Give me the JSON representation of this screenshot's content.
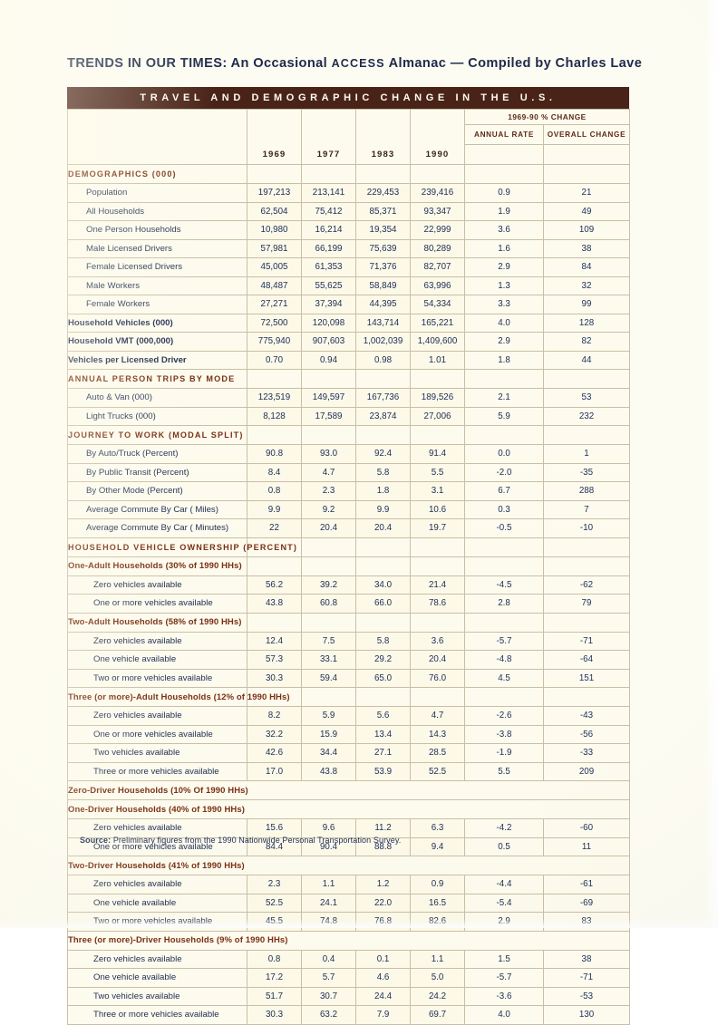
{
  "document": {
    "title_main": "TRENDS IN OUR TIMES:",
    "title_rest_1": " An Occasional ",
    "title_access": "ACCESS",
    "title_rest_2": " Almanac — Compiled by Charles Lave",
    "banner": "TRAVEL AND DEMOGRAPHIC CHANGE IN THE U.S.",
    "source_label": "Source:",
    "source_text": " Preliminary figures from the 1990 Nationwide Personal Transportation Survey."
  },
  "colors": {
    "banner_bg": "#4a2318",
    "section_text": "#7a2f14",
    "data_text": "#20305a",
    "paper": "#fdfbee",
    "rule": "#c9bfa6"
  },
  "table": {
    "header": {
      "group_label": "1969-90 % CHANGE",
      "years": [
        "1969",
        "1977",
        "1983",
        "1990"
      ],
      "annual_rate": "ANNUAL RATE",
      "overall_change": "OVERALL CHANGE"
    },
    "rows": [
      {
        "type": "section",
        "label": "DEMOGRAPHICS (000)"
      },
      {
        "type": "data",
        "indent": 1,
        "label": "Population",
        "values": [
          "197,213",
          "213,141",
          "229,453",
          "239,416",
          "0.9",
          "21"
        ]
      },
      {
        "type": "data",
        "indent": 1,
        "label": "All Households",
        "values": [
          "62,504",
          "75,412",
          "85,371",
          "93,347",
          "1.9",
          "49"
        ]
      },
      {
        "type": "data",
        "indent": 1,
        "label": "One Person Households",
        "values": [
          "10,980",
          "16,214",
          "19,354",
          "22,999",
          "3.6",
          "109"
        ]
      },
      {
        "type": "data",
        "indent": 1,
        "label": "Male Licensed Drivers",
        "values": [
          "57,981",
          "66,199",
          "75,639",
          "80,289",
          "1.6",
          "38"
        ]
      },
      {
        "type": "data",
        "indent": 1,
        "label": "Female Licensed Drivers",
        "values": [
          "45,005",
          "61,353",
          "71,376",
          "82,707",
          "2.9",
          "84"
        ]
      },
      {
        "type": "data",
        "indent": 1,
        "label": "Male Workers",
        "values": [
          "48,487",
          "55,625",
          "58,849",
          "63,996",
          "1.3",
          "32"
        ]
      },
      {
        "type": "data",
        "indent": 1,
        "label": "Female Workers",
        "values": [
          "27,271",
          "37,394",
          "44,395",
          "54,334",
          "3.3",
          "99"
        ]
      },
      {
        "type": "data",
        "indent": 0,
        "bold": true,
        "label": "Household Vehicles (000)",
        "values": [
          "72,500",
          "120,098",
          "143,714",
          "165,221",
          "4.0",
          "128"
        ]
      },
      {
        "type": "data",
        "indent": 0,
        "bold": true,
        "label": "Household VMT (000,000)",
        "values": [
          "775,940",
          "907,603",
          "1,002,039",
          "1,409,600",
          "2.9",
          "82"
        ]
      },
      {
        "type": "data",
        "indent": 0,
        "bold": true,
        "label": "Vehicles per Licensed Driver",
        "values": [
          "0.70",
          "0.94",
          "0.98",
          "1.01",
          "1.8",
          "44"
        ]
      },
      {
        "type": "section",
        "label": "ANNUAL PERSON TRIPS BY MODE"
      },
      {
        "type": "data",
        "indent": 1,
        "label": "Auto & Van (000)",
        "values": [
          "123,519",
          "149,597",
          "167,736",
          "189,526",
          "2.1",
          "53"
        ]
      },
      {
        "type": "data",
        "indent": 1,
        "label": "Light Trucks (000)",
        "values": [
          "8,128",
          "17,589",
          "23,874",
          "27,006",
          "5.9",
          "232"
        ]
      },
      {
        "type": "section",
        "label": "JOURNEY TO WORK (MODAL SPLIT)"
      },
      {
        "type": "data",
        "indent": 1,
        "label": "By Auto/Truck (Percent)",
        "values": [
          "90.8",
          "93.0",
          "92.4",
          "91.4",
          "0.0",
          "1"
        ]
      },
      {
        "type": "data",
        "indent": 1,
        "label": "By Public Transit (Percent)",
        "values": [
          "8.4",
          "4.7",
          "5.8",
          "5.5",
          "-2.0",
          "-35"
        ]
      },
      {
        "type": "data",
        "indent": 1,
        "label": "By Other Mode (Percent)",
        "values": [
          "0.8",
          "2.3",
          "1.8",
          "3.1",
          "6.7",
          "288"
        ]
      },
      {
        "type": "data",
        "indent": 1,
        "label": "Average Commute By Car ( Miles)",
        "values": [
          "9.9",
          "9.2",
          "9.9",
          "10.6",
          "0.3",
          "7"
        ]
      },
      {
        "type": "data",
        "indent": 1,
        "label": "Average Commute By Car ( Minutes)",
        "values": [
          "22",
          "20.4",
          "20.4",
          "19.7",
          "-0.5",
          "-10"
        ]
      },
      {
        "type": "section",
        "label": "HOUSEHOLD VEHICLE OWNERSHIP (PERCENT)"
      },
      {
        "type": "subsection",
        "label": "One-Adult Households (30% of 1990 HHs)"
      },
      {
        "type": "data",
        "indent": 2,
        "label": "Zero vehicles available",
        "values": [
          "56.2",
          "39.2",
          "34.0",
          "21.4",
          "-4.5",
          "-62"
        ]
      },
      {
        "type": "data",
        "indent": 2,
        "label": "One or more vehicles available",
        "values": [
          "43.8",
          "60.8",
          "66.0",
          "78.6",
          "2.8",
          "79"
        ]
      },
      {
        "type": "subsection",
        "label": "Two-Adult Households (58% of 1990 HHs)"
      },
      {
        "type": "data",
        "indent": 2,
        "label": "Zero vehicles available",
        "values": [
          "12.4",
          "7.5",
          "5.8",
          "3.6",
          "-5.7",
          "-71"
        ]
      },
      {
        "type": "data",
        "indent": 2,
        "label": "One vehicle available",
        "values": [
          "57.3",
          "33.1",
          "29.2",
          "20.4",
          "-4.8",
          "-64"
        ]
      },
      {
        "type": "data",
        "indent": 2,
        "label": "Two or more vehicles available",
        "values": [
          "30.3",
          "59.4",
          "65.0",
          "76.0",
          "4.5",
          "151"
        ]
      },
      {
        "type": "subsection",
        "label": "Three (or more)-Adult Households (12% of 1990 HHs)"
      },
      {
        "type": "data",
        "indent": 2,
        "label": "Zero vehicles available",
        "values": [
          "8.2",
          "5.9",
          "5.6",
          "4.7",
          "-2.6",
          "-43"
        ]
      },
      {
        "type": "data",
        "indent": 2,
        "label": "One or more vehicles available",
        "values": [
          "32.2",
          "15.9",
          "13.4",
          "14.3",
          "-3.8",
          "-56"
        ]
      },
      {
        "type": "data",
        "indent": 2,
        "label": "Two vehicles available",
        "values": [
          "42.6",
          "34.4",
          "27.1",
          "28.5",
          "-1.9",
          "-33"
        ]
      },
      {
        "type": "data",
        "indent": 2,
        "label": "Three or more vehicles available",
        "values": [
          "17.0",
          "43.8",
          "53.9",
          "52.5",
          "5.5",
          "209"
        ]
      },
      {
        "type": "subsection",
        "full": true,
        "label": "Zero-Driver Households (10% Of 1990 HHs)"
      },
      {
        "type": "subsection",
        "full": true,
        "label": "One-Driver Households (40% of 1990 HHs)"
      },
      {
        "type": "data",
        "indent": 2,
        "label": "Zero vehicles available",
        "values": [
          "15.6",
          "9.6",
          "11.2",
          "6.3",
          "-4.2",
          "-60"
        ]
      },
      {
        "type": "data",
        "indent": 2,
        "label": "One or more vehicles available",
        "values": [
          "84.4",
          "90.4",
          "88.8",
          "9.4",
          "0.5",
          "11"
        ]
      },
      {
        "type": "subsection",
        "full": true,
        "label": "Two-Driver Households (41% of 1990 HHs)"
      },
      {
        "type": "data",
        "indent": 2,
        "label": "Zero vehicles available",
        "values": [
          "2.3",
          "1.1",
          "1.2",
          "0.9",
          "-4.4",
          "-61"
        ]
      },
      {
        "type": "data",
        "indent": 2,
        "label": "One vehicle available",
        "values": [
          "52.5",
          "24.1",
          "22.0",
          "16.5",
          "-5.4",
          "-69"
        ]
      },
      {
        "type": "data",
        "indent": 2,
        "label": "Two or more vehicles available",
        "values": [
          "45.5",
          "74.8",
          "76.8",
          "82.6",
          "2.9",
          "83"
        ]
      },
      {
        "type": "subsection",
        "full": true,
        "label": "Three (or more)-Driver Households (9% of 1990 HHs)"
      },
      {
        "type": "data",
        "indent": 2,
        "label": "Zero vehicles available",
        "values": [
          "0.8",
          "0.4",
          "0.1",
          "1.1",
          "1.5",
          "38"
        ]
      },
      {
        "type": "data",
        "indent": 2,
        "label": "One vehicle available",
        "values": [
          "17.2",
          "5.7",
          "4.6",
          "5.0",
          "-5.7",
          "-71"
        ]
      },
      {
        "type": "data",
        "indent": 2,
        "label": "Two vehicles available",
        "values": [
          "51.7",
          "30.7",
          "24.4",
          "24.2",
          "-3.6",
          "-53"
        ]
      },
      {
        "type": "data",
        "indent": 2,
        "label": "Three or more vehicles available",
        "values": [
          "30.3",
          "63.2",
          "7.9",
          "69.7",
          "4.0",
          "130"
        ]
      }
    ]
  }
}
